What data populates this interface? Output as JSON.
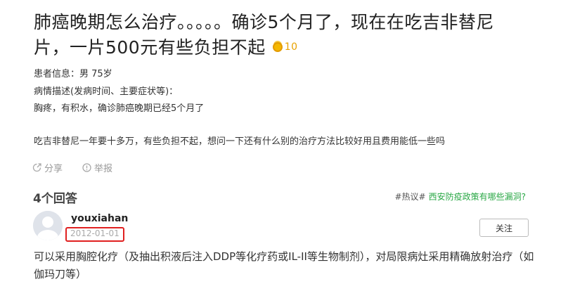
{
  "question": {
    "title": "肺癌晚期怎么治疗。。。。。确诊5个月了，现在在吃吉非替尼片，一片500元有些负担不起",
    "reward": "10",
    "patient_info": "患者信息：男 75岁",
    "condition_label": "病情描述(发病时间、主要症状等)：",
    "condition_text": "胸疼，有积水，确诊肺癌晚期已经5个月了",
    "extra_text": "吃吉非替尼一年要十多万，有些负担不起，想问一下还有什么别的治疗方法比较好用且费用能低一些吗"
  },
  "actions": {
    "share_label": "分享",
    "report_label": "举报"
  },
  "answers": {
    "count_label": "4个回答",
    "hot_tag": "#热议#",
    "hot_link": "西安防疫政策有哪些漏洞?"
  },
  "answer": {
    "username": "youxiahan",
    "date": "2012-01-01",
    "follow_label": "关注",
    "content": "可以采用胸腔化疗（及抽出积液后注入DDP等化疗药或IL-II等生物制剂），对局限病灶采用精确放射治疗（如伽玛刀等）"
  },
  "icons": {
    "coin": "coin-stack-icon",
    "share": "share-icon",
    "report": "report-icon",
    "avatar": "default-avatar-icon"
  },
  "colors": {
    "highlight_box": "#e02020",
    "hot_link": "#2aa846",
    "coin": "#f5b800"
  }
}
